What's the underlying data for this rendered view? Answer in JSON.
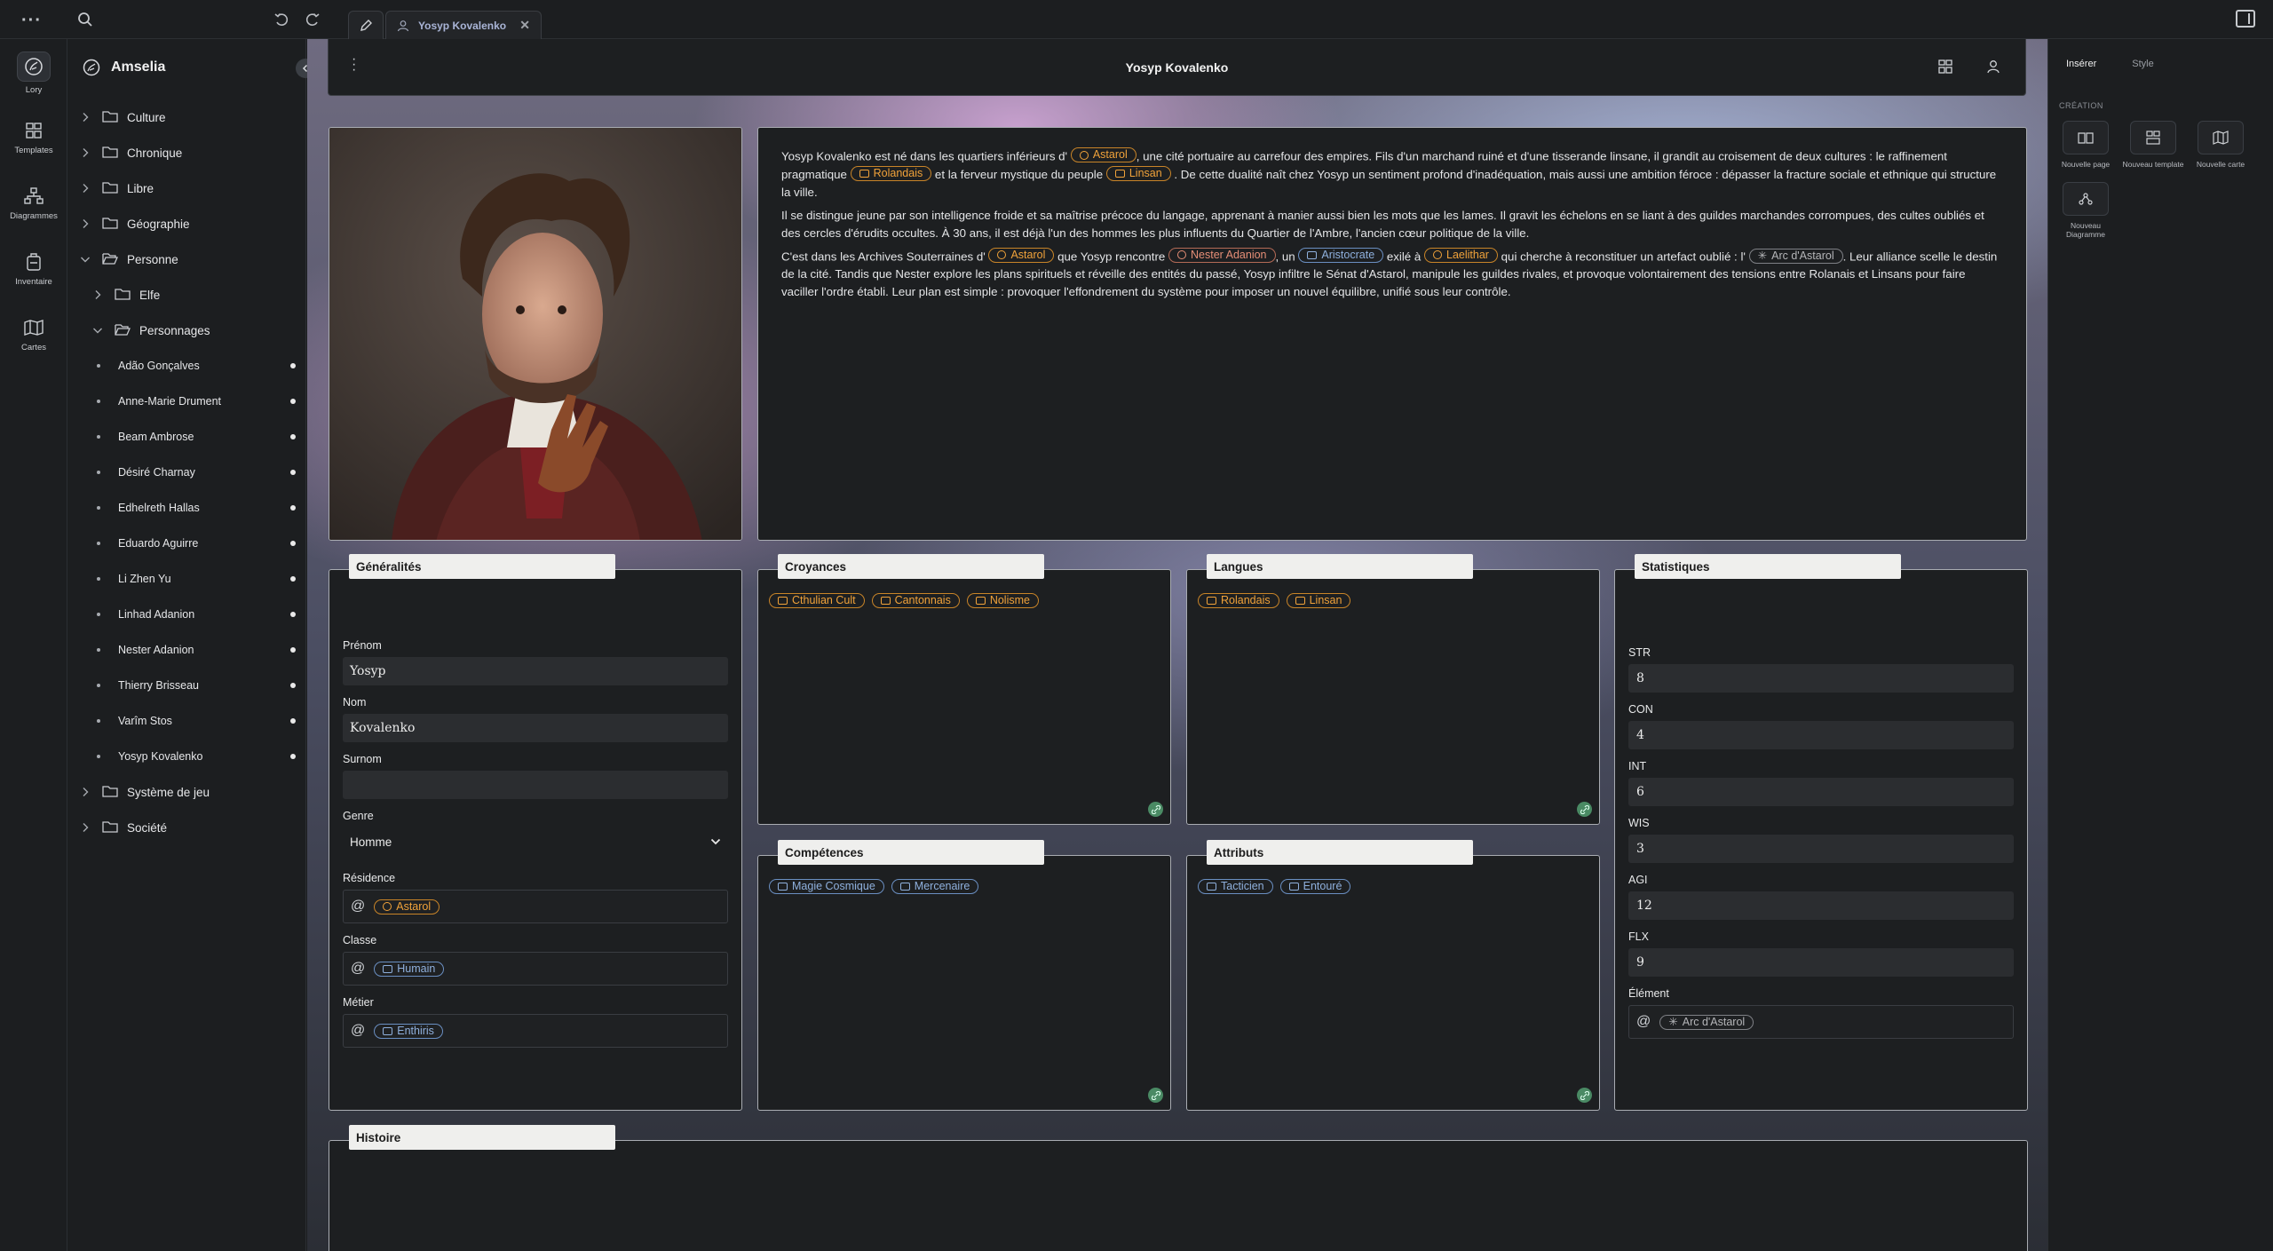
{
  "topbar": {
    "tab_title": "Yosyp Kovalenko"
  },
  "rail": [
    {
      "label": "Lory",
      "icon": "logo-icon"
    },
    {
      "label": "Templates",
      "icon": "templates-icon"
    },
    {
      "label": "Diagrammes",
      "icon": "diagram-icon"
    },
    {
      "label": "Inventaire",
      "icon": "backpack-icon"
    },
    {
      "label": "Cartes",
      "icon": "map-icon"
    }
  ],
  "sidebar": {
    "workspace": "Amselia",
    "tree": [
      {
        "label": "Culture"
      },
      {
        "label": "Chronique"
      },
      {
        "label": "Libre"
      },
      {
        "label": "Géographie"
      },
      {
        "label": "Personne"
      },
      {
        "label": "Elfe"
      },
      {
        "label": "Personnages"
      },
      {
        "label": "Adão Gonçalves"
      },
      {
        "label": "Anne-Marie Drument"
      },
      {
        "label": "Beam Ambrose"
      },
      {
        "label": "Désiré Charnay"
      },
      {
        "label": "Edhelreth Hallas"
      },
      {
        "label": "Eduardo Aguirre"
      },
      {
        "label": "Li Zhen Yu"
      },
      {
        "label": "Linhad Adanion"
      },
      {
        "label": "Nester Adanion"
      },
      {
        "label": "Thierry Brisseau"
      },
      {
        "label": "Varîm Stos"
      },
      {
        "label": "Yosyp Kovalenko"
      },
      {
        "label": "Système de jeu"
      },
      {
        "label": "Société"
      }
    ]
  },
  "document": {
    "title": "Yosyp Kovalenko",
    "bio": {
      "p1": [
        "Yosyp Kovalenko est né dans les quartiers inférieurs d'",
        "Astarol",
        ", une cité portuaire au carrefour des empires. Fils d'un marchand ruiné et d'une tisserande linsane, il grandit au croisement de deux cultures : le raffinement pragmatique",
        "Rolandais",
        "et la ferveur mystique du peuple",
        "Linsan",
        ". De cette dualité naît chez Yosyp un sentiment profond d'inadéquation, mais aussi une ambition féroce : dépasser la fracture sociale et ethnique qui structure la ville."
      ],
      "p2": "Il se distingue jeune par son intelligence froide et sa maîtrise précoce du langage, apprenant à manier aussi bien les mots que les lames. Il gravit les échelons en se liant à des guildes marchandes corrompues, des cultes oubliés et des cercles d'érudits occultes. À 30 ans, il est déjà l'un des hommes les plus influents du Quartier de l'Ambre, l'ancien cœur politique de la ville.",
      "p3": [
        "C'est dans les Archives Souterraines d'",
        "Astarol",
        "que Yosyp rencontre",
        "Nester Adanion",
        ", un",
        "Aristocrate",
        "exilé à",
        "Laelithar",
        "qui cherche à reconstituer un artefact oublié : l'",
        "Arc d'Astarol",
        ". Leur alliance scelle le destin de la cité. Tandis que Nester explore les plans spirituels et réveille des entités du passé, Yosyp infiltre le Sénat d'Astarol, manipule les guildes rivales, et provoque volontairement des tensions entre Rolanais et Linsans pour faire vaciller l'ordre établi. Leur plan est simple : provoquer l'effondrement du système pour imposer un nouvel équilibre, unifié sous leur contrôle."
      ]
    },
    "generalites": {
      "title": "Généralités",
      "prenom_label": "Prénom",
      "prenom": "Yosyp",
      "nom_label": "Nom",
      "nom": "Kovalenko",
      "surnom_label": "Surnom",
      "surnom": "",
      "genre_label": "Genre",
      "genre": "Homme",
      "residence_label": "Résidence",
      "residence": "Astarol",
      "classe_label": "Classe",
      "classe": "Humain",
      "metier_label": "Métier",
      "metier": "Enthiris"
    },
    "croyances": {
      "title": "Croyances",
      "items": [
        "Cthulian Cult",
        "Cantonnais",
        "Nolisme"
      ]
    },
    "langues": {
      "title": "Langues",
      "items": [
        "Rolandais",
        "Linsan"
      ]
    },
    "competences": {
      "title": "Compétences",
      "items": [
        "Magie Cosmique",
        "Mercenaire"
      ]
    },
    "attributs": {
      "title": "Attributs",
      "items": [
        "Tacticien",
        "Entouré"
      ]
    },
    "statistiques": {
      "title": "Statistiques",
      "stats": [
        {
          "label": "STR",
          "value": "8"
        },
        {
          "label": "CON",
          "value": "4"
        },
        {
          "label": "INT",
          "value": "6"
        },
        {
          "label": "WIS",
          "value": "3"
        },
        {
          "label": "AGI",
          "value": "12"
        },
        {
          "label": "FLX",
          "value": "9"
        }
      ],
      "element_label": "Élément",
      "element": "Arc d'Astarol"
    },
    "histoire": {
      "title": "Histoire"
    }
  },
  "right_panel": {
    "tab_insert": "Insérer",
    "tab_style": "Style",
    "section": "CRÉATION",
    "items": [
      {
        "label": "Nouvelle page",
        "icon": "page-icon"
      },
      {
        "label": "Nouveau template",
        "icon": "template-icon"
      },
      {
        "label": "Nouvelle carte",
        "icon": "map-icon"
      },
      {
        "label": "Nouveau Diagramme",
        "icon": "diagram-icon"
      }
    ]
  },
  "colors": {
    "accent_orange": "#f0a23a",
    "accent_blue": "#8fb0dd",
    "add_green": "#4a8a64"
  }
}
